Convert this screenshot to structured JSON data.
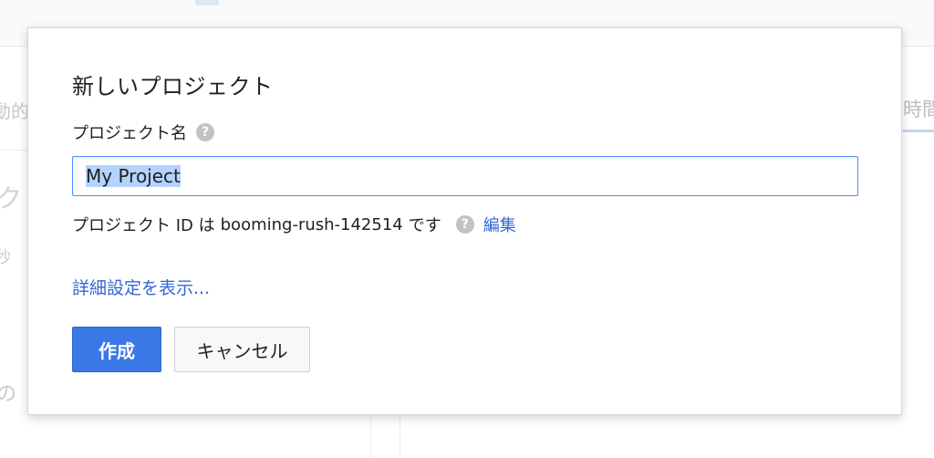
{
  "background": {
    "left_fragments": [
      "動的",
      "ク",
      "秒",
      "の"
    ],
    "right_fragment": "時間"
  },
  "dialog": {
    "title": "新しいプロジェクト",
    "project_name_label": "プロジェクト名",
    "help_icon_glyph": "?",
    "project_name_value": "My Project",
    "project_id_prefix": "プロジェクト ID は",
    "project_id": "booming-rush-142514",
    "project_id_suffix": "です",
    "edit_link": "編集",
    "advanced_link": "詳細設定を表示...",
    "create_button": "作成",
    "cancel_button": "キャンセル"
  },
  "colors": {
    "primary": "#3b78e7",
    "link": "#3367d6",
    "input_focus_border": "#4d90fe",
    "selection": "#b3d4fc",
    "help_icon": "#c2c2c2"
  },
  "icons": [
    "help-icon"
  ]
}
